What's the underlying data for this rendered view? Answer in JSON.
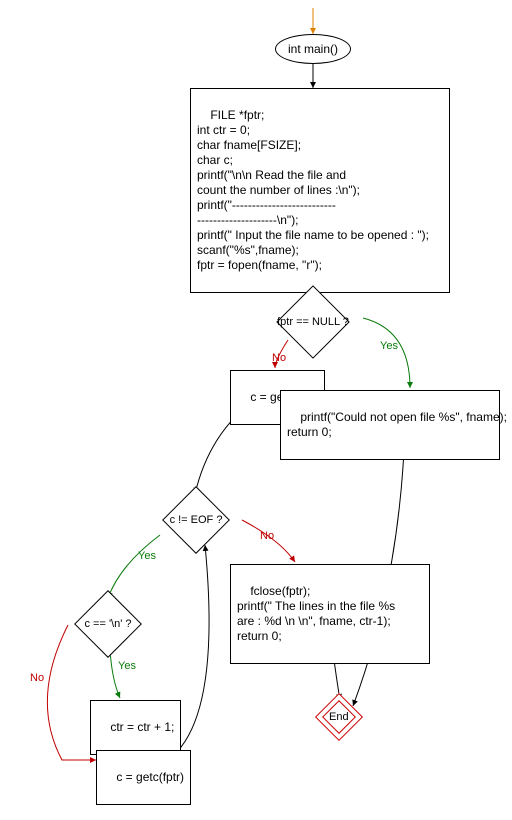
{
  "flow": {
    "start": {
      "label": "int main()"
    },
    "init_block": "FILE *fptr;\nint ctr = 0;\nchar fname[FSIZE];\nchar c;\nprintf(\"\\n\\n Read the file and\ncount the number of lines :\\n\");\nprintf(\"--------------------------\n--------------------\\n\");\nprintf(\" Input the file name to be opened : \");\nscanf(\"%s\",fname);\nfptr = fopen(fname, \"r\");",
    "cond_fptr": "fptr == NULL ?",
    "stmt_getc1": "c = getc(fptr)",
    "branch_null": "printf(\"Could not open file %s\", fname);\nreturn 0;",
    "cond_eof": "c != EOF ?",
    "close_block": "fclose(fptr);\nprintf(\" The lines in the file %s\nare : %d \\n \\n\", fname, ctr-1);\nreturn 0;",
    "cond_newline": "c == '\\n' ?",
    "stmt_incr": "ctr = ctr + 1;",
    "stmt_getc2": "c = getc(fptr)",
    "end": "End",
    "labels": {
      "yes": "Yes",
      "no": "No"
    }
  }
}
